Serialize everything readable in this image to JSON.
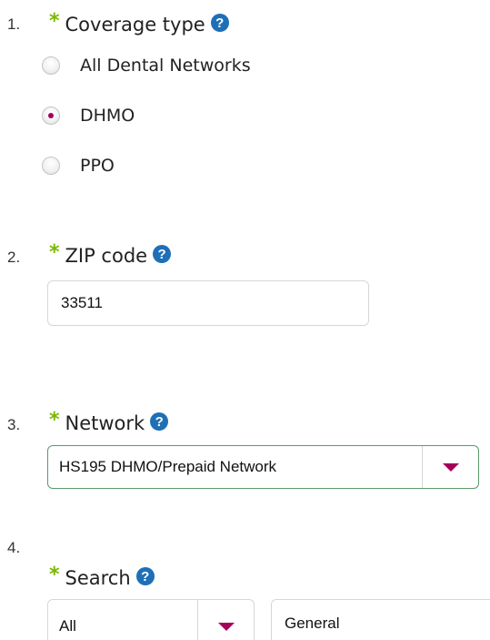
{
  "questions": [
    {
      "number": "1.",
      "label": "Coverage type",
      "required_mark": "*",
      "help": "?",
      "options": [
        {
          "label": "All Dental Networks",
          "selected": false
        },
        {
          "label": "DHMO",
          "selected": true
        },
        {
          "label": "PPO",
          "selected": false
        }
      ]
    },
    {
      "number": "2.",
      "label": "ZIP code",
      "required_mark": "*",
      "help": "?",
      "value": "33511"
    },
    {
      "number": "3.",
      "label": "Network",
      "required_mark": "*",
      "help": "?",
      "selected": "HS195 DHMO/Prepaid Network"
    },
    {
      "number": "4.",
      "label": "Search",
      "required_mark": "*",
      "help": "?",
      "scope_selected": "All",
      "search_value": "General"
    }
  ],
  "colors": {
    "accent": "#a3005a",
    "required": "#7ab800",
    "help": "#1f6fb6",
    "network_border": "#5a9a6a"
  },
  "icons": {
    "help": "question-circle-icon",
    "dropdown": "caret-down-icon",
    "radio": "radio-button-icon"
  }
}
